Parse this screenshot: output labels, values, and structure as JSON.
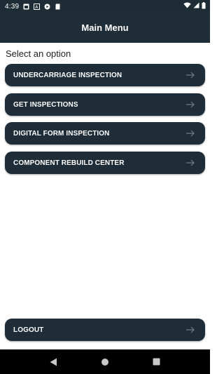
{
  "status_bar": {
    "time": "4:39",
    "icons": [
      "android-icon",
      "sim-icon",
      "media-icon",
      "sd-card-icon"
    ],
    "right_icons": [
      "wifi-icon",
      "signal-icon",
      "battery-icon"
    ]
  },
  "app_bar": {
    "title": "Main Menu"
  },
  "prompt": "Select an option",
  "menu": {
    "items": [
      {
        "label": "UNDERCARRIAGE INSPECTION",
        "icon": "arrow-right-icon"
      },
      {
        "label": "GET INSPECTIONS",
        "icon": "arrow-right-icon"
      },
      {
        "label": "DIGITAL FORM INSPECTION",
        "icon": "arrow-right-icon"
      },
      {
        "label": "COMPONENT REBUILD CENTER",
        "icon": "arrow-right-icon"
      }
    ],
    "logout": {
      "label": "LOGOUT",
      "icon": "arrow-right-icon"
    }
  },
  "nav_bar": {
    "icons": [
      "back-icon",
      "home-icon",
      "recents-icon"
    ]
  },
  "colors": {
    "primary": "#1f2d38",
    "background": "#ffffff"
  }
}
